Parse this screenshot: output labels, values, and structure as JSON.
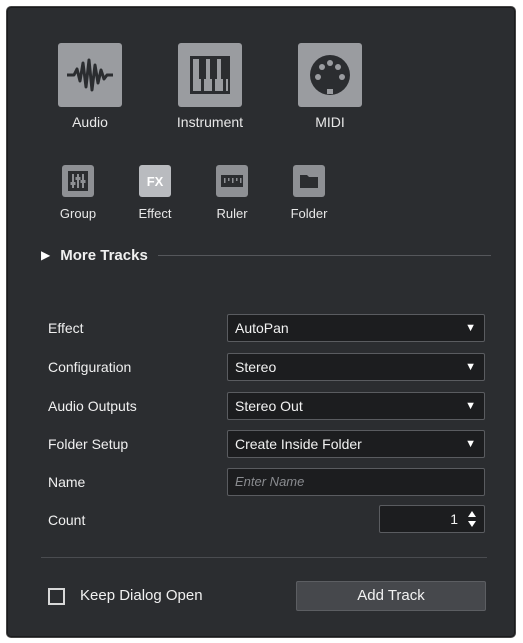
{
  "track_types_main": [
    {
      "label": "Audio",
      "icon": "waveform-icon"
    },
    {
      "label": "Instrument",
      "icon": "piano-keys-icon"
    },
    {
      "label": "MIDI",
      "icon": "midi-connector-icon"
    }
  ],
  "track_types_small": [
    {
      "label": "Group",
      "icon": "group-fader-icon"
    },
    {
      "label": "Effect",
      "icon": "fx-icon",
      "glyph": "FX"
    },
    {
      "label": "Ruler",
      "icon": "ruler-icon"
    },
    {
      "label": "Folder",
      "icon": "folder-icon"
    }
  ],
  "more_tracks": {
    "label": "More Tracks",
    "arrow": "▶"
  },
  "form": {
    "effect": {
      "label": "Effect",
      "value": "AutoPan"
    },
    "configuration": {
      "label": "Configuration",
      "value": "Stereo"
    },
    "audio_outputs": {
      "label": "Audio Outputs",
      "value": "Stereo Out"
    },
    "folder_setup": {
      "label": "Folder Setup",
      "value": "Create Inside Folder"
    },
    "name": {
      "label": "Name",
      "placeholder": "Enter Name"
    },
    "count": {
      "label": "Count",
      "value": "1"
    },
    "dropdown_caret": "▼"
  },
  "footer": {
    "keep_open_label": "Keep Dialog Open",
    "keep_open_checked": false,
    "add_track_label": "Add Track"
  },
  "colors": {
    "dialog_bg": "#2b2d30",
    "button_bg": "#9a9ca0",
    "active_button_bg": "#b9bbbf",
    "field_bg": "#1c1d1f"
  }
}
